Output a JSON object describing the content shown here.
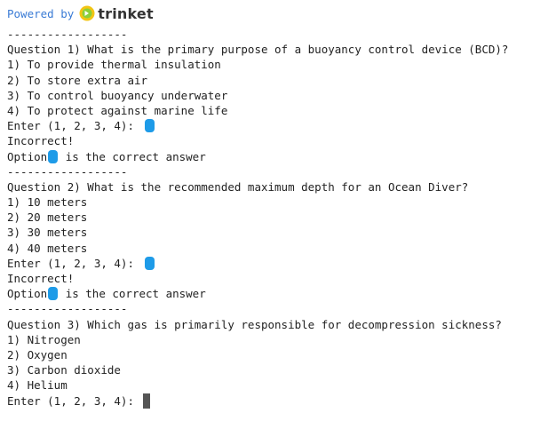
{
  "header": {
    "powered_by": "Powered by",
    "brand": "trinket",
    "brand_color": "#3a7bd5"
  },
  "separator": "------------------",
  "blob_color": "#1e9be8",
  "questions": [
    {
      "prompt": "Question 1) What is the primary purpose of a buoyancy control device (BCD)?",
      "options": [
        "1) To provide thermal insulation",
        "2) To store extra air",
        "3) To control buoyancy underwater",
        "4) To protect against marine life"
      ],
      "enter": "Enter (1, 2, 3, 4):",
      "result": "Incorrect!",
      "answer_pre": "Option",
      "answer_post": "is the correct answer"
    },
    {
      "prompt": "Question 2) What is the recommended maximum depth for an Ocean Diver?",
      "options": [
        "1) 10 meters",
        "2) 20 meters",
        "3) 30 meters",
        "4) 40 meters"
      ],
      "enter": "Enter (1, 2, 3, 4):",
      "result": "Incorrect!",
      "answer_pre": "Option",
      "answer_post": "is the correct answer"
    },
    {
      "prompt": "Question 3) Which gas is primarily responsible for decompression sickness?",
      "options": [
        "1) Nitrogen",
        "2) Oxygen",
        "3) Carbon dioxide",
        "4) Helium"
      ],
      "enter": "Enter (1, 2, 3, 4):"
    }
  ]
}
